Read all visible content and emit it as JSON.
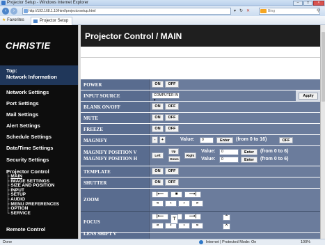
{
  "window": {
    "title": "Projector Setup - Windows Internet Explorer"
  },
  "browser": {
    "address": "http://192.168.1.10/html/projectorsetup.html",
    "search_placeholder": "Bing",
    "favorites_label": "Favorites",
    "tab_label": "Projector Setup"
  },
  "sidebar": {
    "logo": "CHRISTIE",
    "top_line1": "Top:",
    "top_line2": "Network Information",
    "items": [
      "Network Settings",
      "Port Settings",
      "Mail Settings",
      "Alert Settings",
      "Schedule Settings",
      "Date/Time Settings",
      "Security Settings"
    ],
    "group": "Projector Control",
    "subitems": [
      "MAIN",
      "IMAGE SETTINGS",
      "SIZE AND POSITION",
      "INPUT",
      "SETUP",
      "AUDIO",
      "MENU PREFERENCES",
      "OPTION",
      "SERVICE"
    ],
    "bottom": "Remote Control"
  },
  "main": {
    "title": "Projector Control / MAIN",
    "on": "ON",
    "off": "OFF",
    "apply": "Apply",
    "enter": "Enter",
    "rows": {
      "power": "POWER",
      "input_source": "INPUT SOURCE",
      "blank": "BLANK ON/OFF",
      "mute": "MUTE",
      "freeze": "FREEZE",
      "magnify": "MAGNIFY",
      "magnify_pos_v": "MAGNIFY POSITION V",
      "magnify_pos_h": "MAGNIFY POSITION H",
      "template": "TEMPLATE",
      "shutter": "SHUTTER",
      "zoom": "ZOOM",
      "focus": "FOCUS",
      "lens_shift_v": "LENS SHIFT V"
    },
    "input_source_value": "COMPUTER IN",
    "magnify_minus": "-",
    "magnify_plus": "+",
    "value_label": "Value:",
    "magnify_value": "0",
    "magnify_range": "(from 0 to 16)",
    "pos_v_value": "0",
    "pos_h_value": "0",
    "pos_range": "(from 0 to 6)",
    "left_label": "Left",
    "up_label": "Up",
    "down_label": "Down",
    "right_label": "Right"
  },
  "status": {
    "left": "Done",
    "zone": "Internet | Protected Mode: On",
    "zoom": "100%"
  }
}
